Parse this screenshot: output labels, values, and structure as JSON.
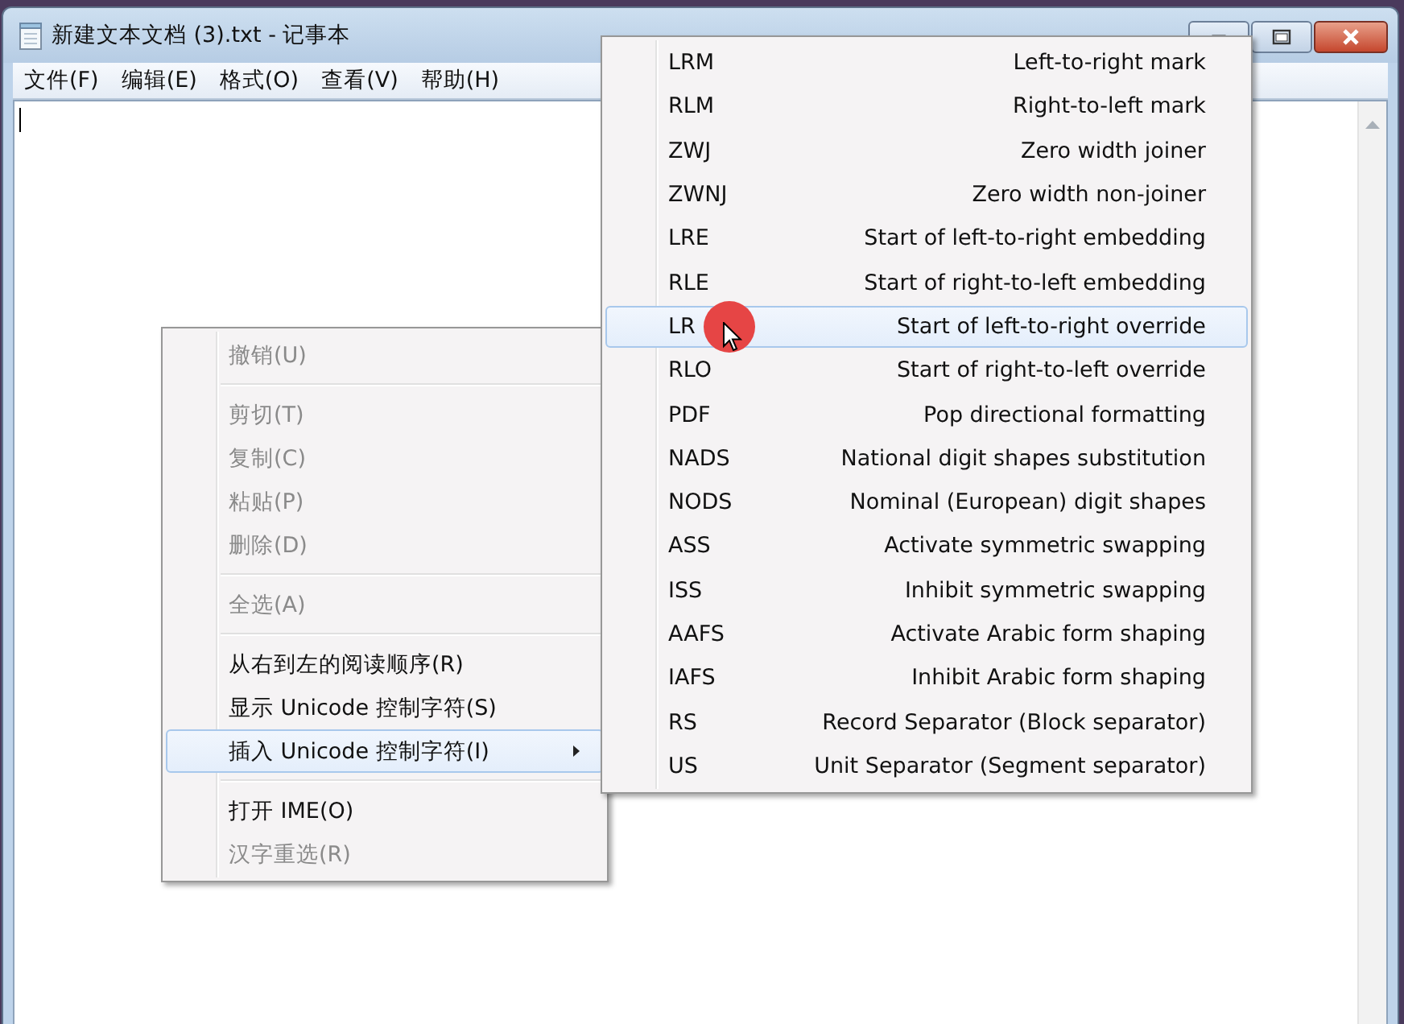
{
  "window": {
    "title": "新建文本文档 (3).txt - 记事本"
  },
  "menu_bar": [
    {
      "label": "文件(F)"
    },
    {
      "label": "编辑(E)"
    },
    {
      "label": "格式(O)"
    },
    {
      "label": "查看(V)"
    },
    {
      "label": "帮助(H)"
    }
  ],
  "context_menu": {
    "items": [
      {
        "kind": "item",
        "label": "撤销(U)",
        "disabled": true,
        "selected": false
      },
      {
        "kind": "separator"
      },
      {
        "kind": "item",
        "label": "剪切(T)",
        "disabled": true,
        "selected": false
      },
      {
        "kind": "item",
        "label": "复制(C)",
        "disabled": true,
        "selected": false
      },
      {
        "kind": "item",
        "label": "粘贴(P)",
        "disabled": true,
        "selected": false
      },
      {
        "kind": "item",
        "label": "删除(D)",
        "disabled": true,
        "selected": false
      },
      {
        "kind": "separator"
      },
      {
        "kind": "item",
        "label": "全选(A)",
        "disabled": true,
        "selected": false
      },
      {
        "kind": "separator"
      },
      {
        "kind": "item",
        "label": "从右到左的阅读顺序(R)",
        "disabled": false,
        "selected": false
      },
      {
        "kind": "item",
        "label": "显示 Unicode 控制字符(S)",
        "disabled": false,
        "selected": false
      },
      {
        "kind": "submenu",
        "label": "插入 Unicode 控制字符(I)",
        "disabled": false,
        "selected": true
      },
      {
        "kind": "separator"
      },
      {
        "kind": "item",
        "label": "打开 IME(O)",
        "disabled": false,
        "selected": false
      },
      {
        "kind": "item",
        "label": "汉字重选(R)",
        "disabled": true,
        "selected": false
      }
    ]
  },
  "submenu": {
    "items": [
      {
        "code": "LRM",
        "label": "Left-to-right mark",
        "selected": false
      },
      {
        "code": "RLM",
        "label": "Right-to-left mark",
        "selected": false
      },
      {
        "code": "ZWJ",
        "label": "Zero width joiner",
        "selected": false
      },
      {
        "code": "ZWNJ",
        "label": "Zero width non-joiner",
        "selected": false
      },
      {
        "code": "LRE",
        "label": "Start of left-to-right embedding",
        "selected": false
      },
      {
        "code": "RLE",
        "label": "Start of right-to-left embedding",
        "selected": false
      },
      {
        "code": "LR",
        "label": "Start of left-to-right override",
        "selected": true
      },
      {
        "code": "RLO",
        "label": "Start of right-to-left override",
        "selected": false
      },
      {
        "code": "PDF",
        "label": "Pop directional formatting",
        "selected": false
      },
      {
        "code": "NADS",
        "label": "National digit shapes substitution",
        "selected": false
      },
      {
        "code": "NODS",
        "label": "Nominal (European) digit shapes",
        "selected": false
      },
      {
        "code": "ASS",
        "label": "Activate symmetric swapping",
        "selected": false
      },
      {
        "code": "ISS",
        "label": "Inhibit symmetric swapping",
        "selected": false
      },
      {
        "code": "AAFS",
        "label": "Activate Arabic form shaping",
        "selected": false
      },
      {
        "code": "IAFS",
        "label": "Inhibit Arabic form shaping",
        "selected": false
      },
      {
        "code": "RS",
        "label": "Record Separator (Block separator)",
        "selected": false
      },
      {
        "code": "US",
        "label": "Unit Separator (Segment separator)",
        "selected": false
      }
    ]
  }
}
